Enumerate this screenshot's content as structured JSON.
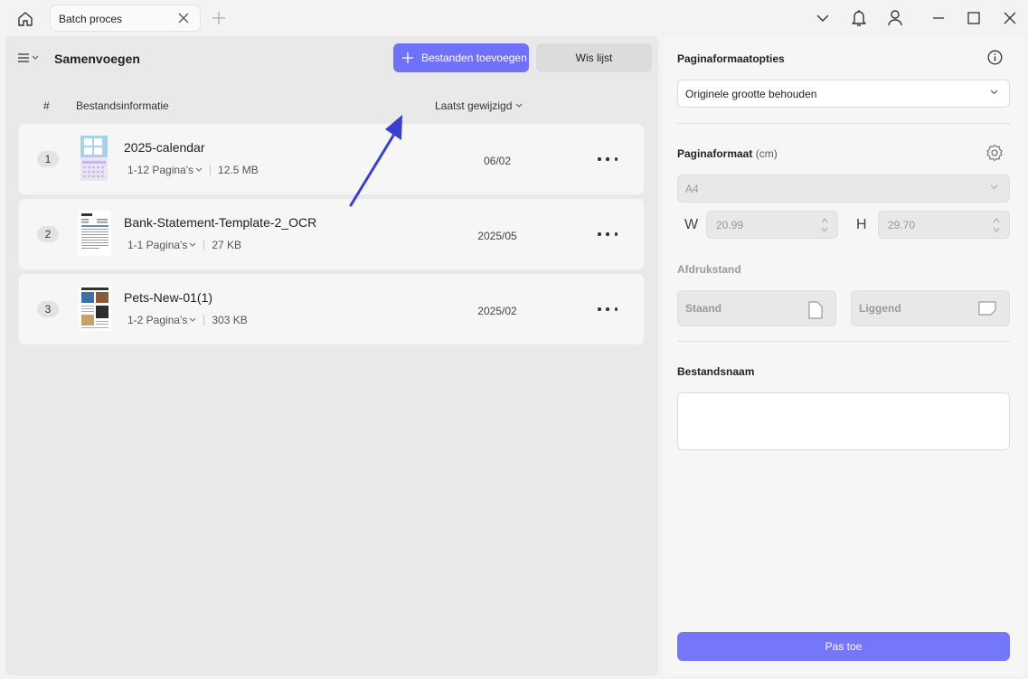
{
  "titlebar": {
    "tab_label": "Batch proces"
  },
  "left": {
    "title": "Samenvoegen",
    "add_button": "Bestanden toevoegen",
    "clear_button": "Wis lijst",
    "columns": {
      "num": "#",
      "info": "Bestandsinformatie",
      "modified": "Laatst gewijzigd"
    },
    "files": [
      {
        "num": "1",
        "name": "2025-calendar",
        "pages": "1-12 Pagina's",
        "size": "12.5 MB",
        "date": "06/02"
      },
      {
        "num": "2",
        "name": "Bank-Statement-Template-2_OCR",
        "pages": "1-1 Pagina's",
        "size": "27 KB",
        "date": "2025/05"
      },
      {
        "num": "3",
        "name": "Pets-New-01(1)",
        "pages": "1-2 Pagina's",
        "size": "303 KB",
        "date": "2025/02"
      }
    ]
  },
  "right": {
    "page_format_options_label": "Paginaformaatopties",
    "page_format_select": "Originele grootte behouden",
    "page_size_label": "Paginaformaat",
    "page_size_unit": "(cm)",
    "page_size_select": "A4",
    "width_letter": "W",
    "width_value": "20.99",
    "height_letter": "H",
    "height_value": "29.70",
    "orientation_label": "Afdrukstand",
    "portrait": "Staand",
    "landscape": "Liggend",
    "filename_label": "Bestandsnaam",
    "filename_value": "",
    "apply_button": "Pas toe"
  },
  "colors": {
    "accent": "#6f72f8",
    "arrow": "#3b3fd0"
  }
}
